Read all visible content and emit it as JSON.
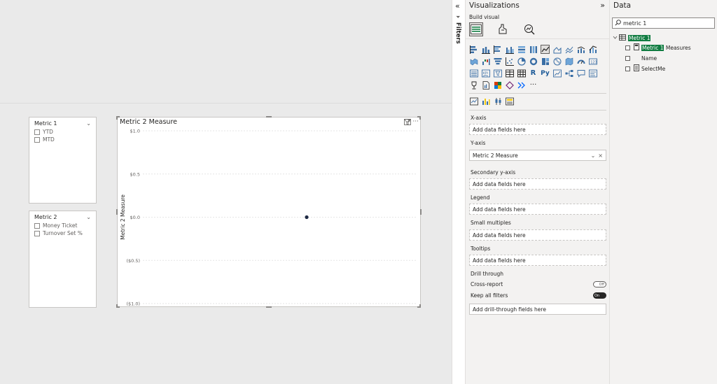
{
  "canvas": {
    "slicer1": {
      "title": "Metric 1",
      "items": [
        "YTD",
        "MTD"
      ]
    },
    "slicer2": {
      "title": "Metric 2",
      "items": [
        "Money Ticket",
        "Turnover Set %"
      ]
    },
    "visual": {
      "title": "Metric 2 Measure",
      "y_axis_label": "Metric 2 Measure",
      "icons": [
        "filter-icon",
        "focus-mode-icon",
        "more-options-icon"
      ]
    }
  },
  "chart_data": {
    "type": "scatter",
    "ylabel": "Metric 2 Measure",
    "yticks": [
      "$1.0",
      "$0.5",
      "$0.0",
      "($0.5)",
      "($1.0)"
    ],
    "ylim": [
      -1.0,
      1.0
    ],
    "points": [
      {
        "y": 0.0
      }
    ],
    "grid": true,
    "point_color": "#1f2a44"
  },
  "filters_pane": {
    "label": "Filters",
    "collapse_glyph": "«",
    "funnel_glyph": "⏷"
  },
  "visualizations_pane": {
    "title": "Visualizations",
    "collapse_glyph": "»",
    "build_label": "Build visual",
    "tabs": [
      "build-visual",
      "format-visual",
      "analytics"
    ],
    "more_glyph": "···",
    "wells": {
      "x_axis": {
        "label": "X-axis",
        "placeholder": "Add data fields here"
      },
      "y_axis": {
        "label": "Y-axis",
        "field": "Metric 2 Measure",
        "field_ctrls": [
          "⌄",
          "×"
        ]
      },
      "secondary_y_axis": {
        "label": "Secondary y-axis",
        "placeholder": "Add data fields here"
      },
      "legend": {
        "label": "Legend",
        "placeholder": "Add data fields here"
      },
      "small_multiples": {
        "label": "Small multiples",
        "placeholder": "Add data fields here"
      },
      "tooltips": {
        "label": "Tooltips",
        "placeholder": "Add data fields here"
      }
    },
    "drill_through": {
      "label": "Drill through",
      "cross_report": {
        "label": "Cross-report",
        "state": "Off"
      },
      "keep_all_filters": {
        "label": "Keep all filters",
        "state": "On"
      },
      "placeholder": "Add drill-through fields here"
    }
  },
  "data_pane": {
    "title": "Data",
    "search_value": "metric 1",
    "tree": {
      "table": "Metric 1",
      "fields": [
        {
          "name_highlight": "Metric 1",
          "name_rest": " Measures"
        },
        {
          "name": "Name"
        },
        {
          "name": "SelectMe"
        }
      ]
    }
  },
  "colors": {
    "accent": "#107c41",
    "canvas_bg": "#eaeaea",
    "pane_bg": "#f3f2f1"
  }
}
